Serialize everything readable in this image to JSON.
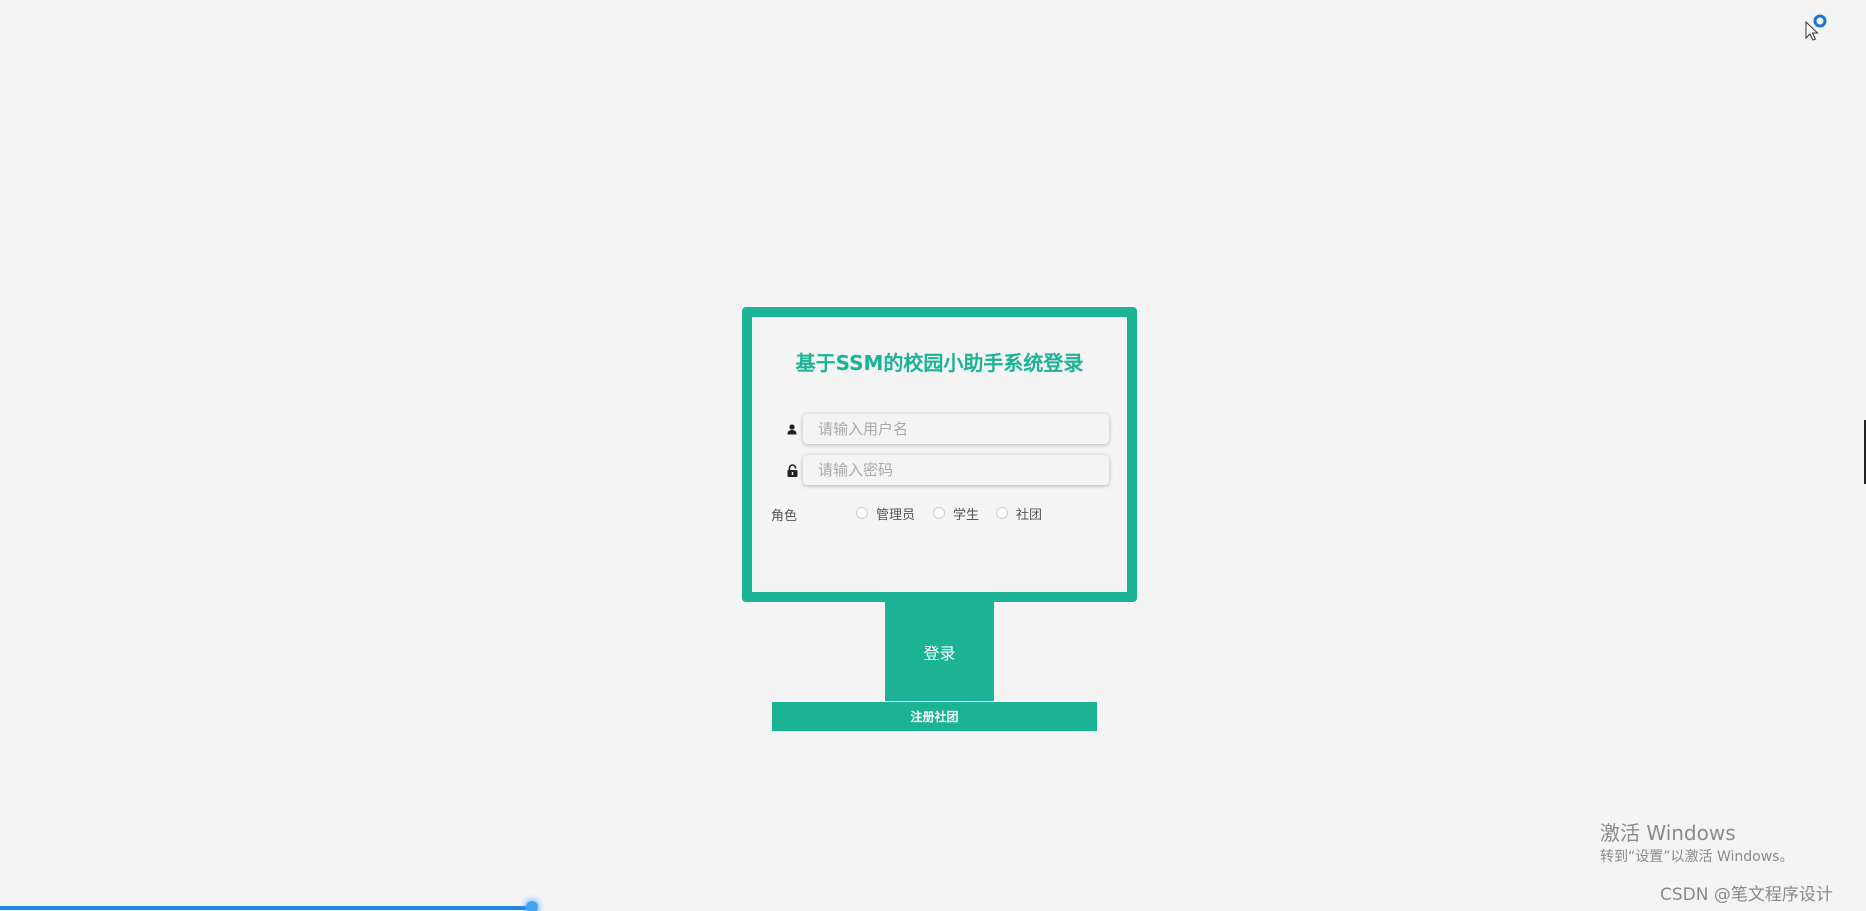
{
  "login": {
    "title": "基于SSM的校园小助手系统登录",
    "username": {
      "placeholder": "请输入用户名",
      "value": ""
    },
    "password": {
      "placeholder": "请输入密码",
      "value": ""
    },
    "role_label": "角色",
    "roles": [
      {
        "label": "管理员",
        "selected": false
      },
      {
        "label": "学生",
        "selected": false
      },
      {
        "label": "社团",
        "selected": false
      }
    ],
    "login_label": "登录",
    "register_label": "注册社团"
  },
  "watermark": {
    "title": "激活 Windows",
    "subtitle": "转到“设置”以激活 Windows。"
  },
  "credit": "CSDN @笔文程序设计",
  "page_progress": 0.285,
  "colors": {
    "accent": "#1ab394",
    "background": "#f4f4f4",
    "progress": "#1e88e5"
  },
  "icons": {
    "username": "user-icon",
    "password": "lock-icon",
    "cursor": "busy-cursor-icon"
  }
}
